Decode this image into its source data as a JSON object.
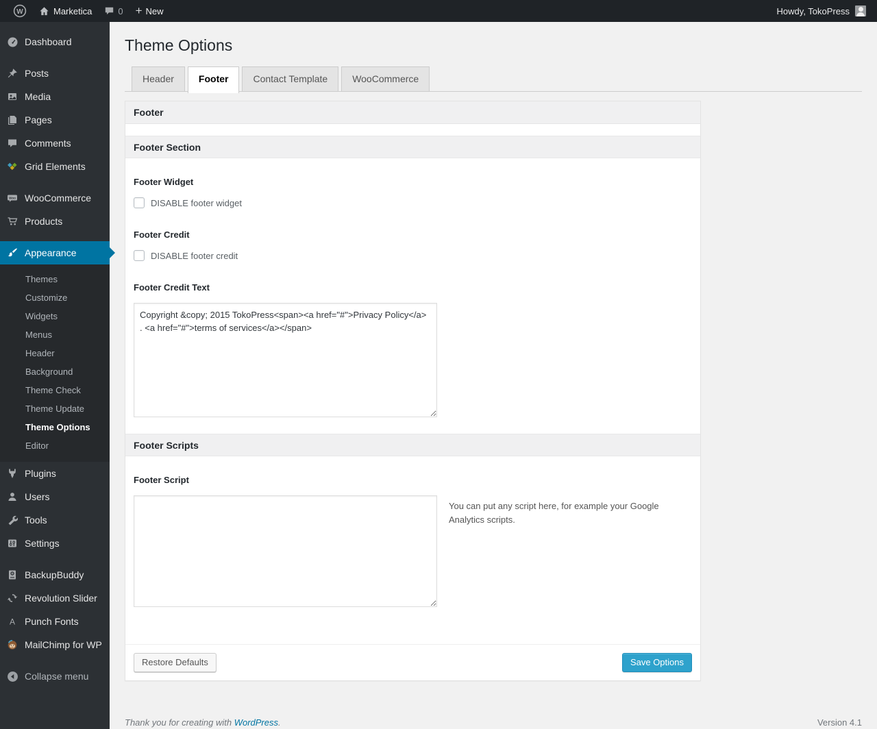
{
  "colors": {
    "accent": "#0074a2",
    "save_button": "#2ea2cc",
    "menu_highlight": "#0074a2"
  },
  "admin_bar": {
    "site_name": "Marketica",
    "comment_count": "0",
    "new_label": "New",
    "howdy": "Howdy, TokoPress"
  },
  "sidebar": {
    "items": [
      {
        "label": "Dashboard"
      },
      {
        "label": "Posts"
      },
      {
        "label": "Media"
      },
      {
        "label": "Pages"
      },
      {
        "label": "Comments"
      },
      {
        "label": "Grid Elements"
      },
      {
        "label": "WooCommerce"
      },
      {
        "label": "Products"
      },
      {
        "label": "Appearance"
      },
      {
        "label": "Plugins"
      },
      {
        "label": "Users"
      },
      {
        "label": "Tools"
      },
      {
        "label": "Settings"
      },
      {
        "label": "BackupBuddy"
      },
      {
        "label": "Revolution Slider"
      },
      {
        "label": "Punch Fonts"
      },
      {
        "label": "MailChimp for WP"
      }
    ],
    "active_item": "Appearance",
    "appearance_submenu": [
      "Themes",
      "Customize",
      "Widgets",
      "Menus",
      "Header",
      "Background",
      "Theme Check",
      "Theme Update",
      "Theme Options",
      "Editor"
    ],
    "active_submenu_item": "Theme Options",
    "collapse_label": "Collapse menu"
  },
  "main": {
    "title": "Theme Options",
    "tabs": [
      {
        "label": "Header",
        "active": false
      },
      {
        "label": "Footer",
        "active": true
      },
      {
        "label": "Contact Template",
        "active": false
      },
      {
        "label": "WooCommerce",
        "active": false
      }
    ],
    "panel": {
      "box_title": "Footer",
      "section1_title": "Footer Section",
      "footer_widget_label": "Footer Widget",
      "footer_widget_checkbox_label": "DISABLE footer widget",
      "footer_credit_label": "Footer Credit",
      "footer_credit_checkbox_label": "DISABLE footer credit",
      "footer_credit_text_label": "Footer Credit Text",
      "footer_credit_text_value": "Copyright &copy; 2015 TokoPress<span><a href=\"#\">Privacy Policy</a> . <a href=\"#\">terms of services</a></span>",
      "section2_title": "Footer Scripts",
      "footer_script_label": "Footer Script",
      "footer_script_value": "",
      "footer_script_help": "You can put any script here, for example your Google Analytics scripts.",
      "restore_button_label": "Restore Defaults",
      "save_button_label": "Save Options"
    }
  },
  "page_footer": {
    "thanks_prefix": "Thank you for creating with ",
    "wordpress_link_label": "WordPress",
    "thanks_suffix": ".",
    "version": "Version 4.1"
  }
}
